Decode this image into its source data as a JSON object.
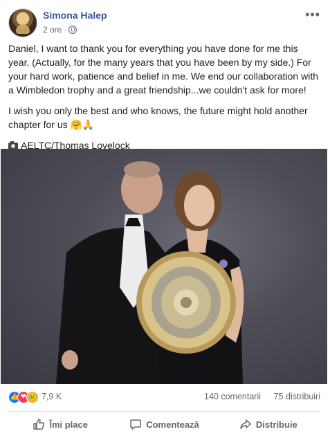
{
  "post": {
    "author": "Simona Halep",
    "time": "2 ore",
    "separator": "·",
    "more": "•••",
    "paragraphs": [
      "Daniel, I want to thank you for everything you have done for me this year. (Actually, for the many years that you have been by my side.) For your hard work, patience and belief in me. We end our collaboration with a Wimbledon trophy and a great friendship...we couldn't ask for more!",
      "I wish you only the best and who knows, the future might hold another chapter for us 🤗🙏"
    ],
    "credit": "AELTC/Thomas Lovelock"
  },
  "stats": {
    "reactions_count": "7,9 K",
    "comments": "140 comentarii",
    "shares": "75 distribuiri"
  },
  "actions": {
    "like": "Îmi place",
    "comment": "Comentează",
    "share": "Distribuie"
  },
  "colors": {
    "author_link": "#385898",
    "like_blue": "#1877f2",
    "love_red": "#f33e58",
    "sad_yellow": "#f7b125",
    "muted": "#606770"
  }
}
